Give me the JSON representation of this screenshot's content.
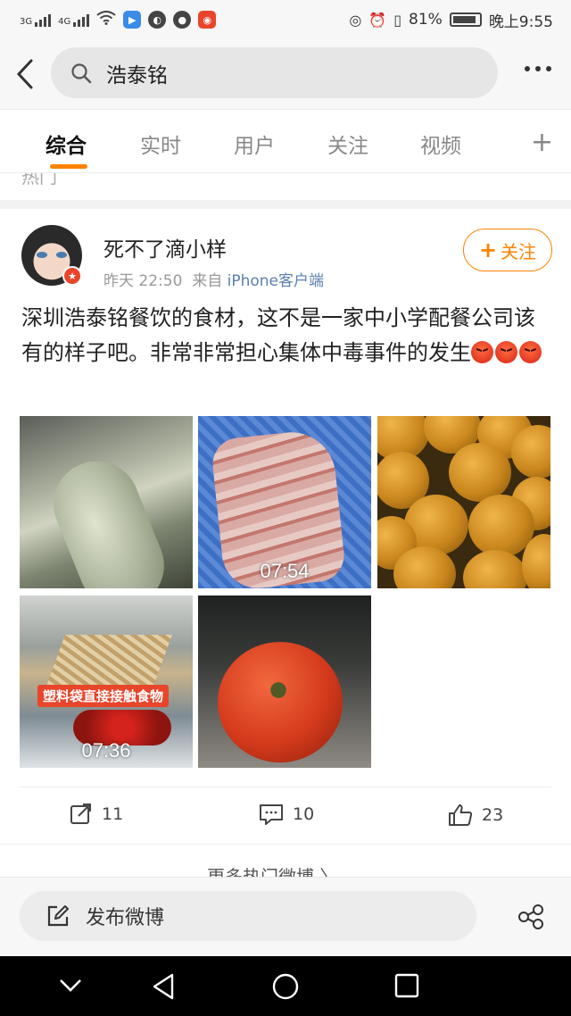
{
  "status_bar": {
    "sim1": "3G",
    "sim2": "4G",
    "battery": "81%",
    "time": "晚上9:55"
  },
  "search": {
    "query": "浩泰铭",
    "icons": {
      "back": "back-arrow-icon",
      "search": "search-icon",
      "more": "more-dots-icon"
    }
  },
  "tabs": [
    {
      "label": "综合",
      "active": true
    },
    {
      "label": "实时",
      "active": false
    },
    {
      "label": "用户",
      "active": false
    },
    {
      "label": "关注",
      "active": false
    },
    {
      "label": "视频",
      "active": false
    }
  ],
  "tab_add": "+",
  "hot_strip": {
    "label": "热门"
  },
  "post": {
    "username": "死不了滴小样",
    "time": "昨天 22:50",
    "source_prefix": "来自",
    "source": "iPhone客户端",
    "follow_label": "关注",
    "text": "深圳浩泰铭餐饮的食材，这不是一家中小学配餐公司该有的样子吧。非常非常担心集体中毒事件的发生",
    "emoji_count": 3,
    "photos": [
      {
        "subject": "cucumber"
      },
      {
        "subject": "meat",
        "duration": "07:54"
      },
      {
        "subject": "oranges"
      },
      {
        "subject": "kitchen",
        "duration": "07:36",
        "caption": "塑料袋直接接触食物"
      },
      {
        "subject": "tomato"
      }
    ],
    "actions": {
      "repost_count": "11",
      "comment_count": "10",
      "like_count": "23"
    }
  },
  "more_hot": {
    "label": "更多热门微博 〉"
  },
  "compose": {
    "placeholder": "发布微博"
  },
  "colors": {
    "accent": "#ff8200",
    "link": "#5b7fb0"
  }
}
